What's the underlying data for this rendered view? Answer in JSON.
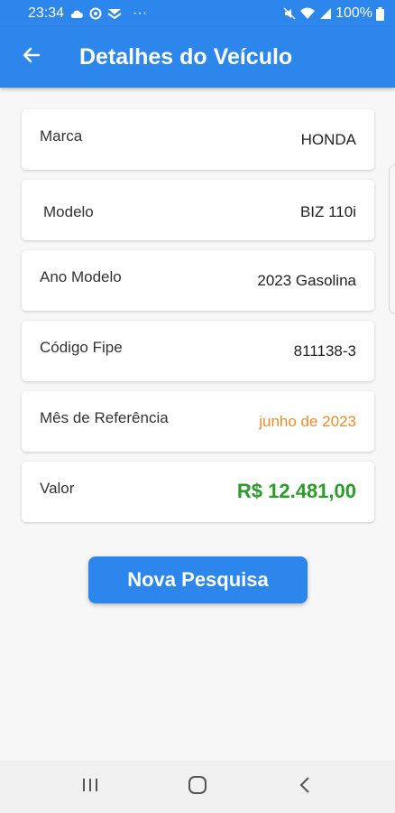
{
  "status_bar": {
    "time": "23:34",
    "more": "···",
    "battery": "100%",
    "icons": [
      "cloud-icon",
      "sync-icon",
      "message-icon",
      "mute-icon",
      "wifi-icon",
      "signal-icon",
      "battery-icon"
    ]
  },
  "app_bar": {
    "title": "Detalhes do Veículo",
    "back_icon": "arrow-left-icon"
  },
  "details": [
    {
      "label": "Marca",
      "value": "HONDA"
    },
    {
      "label": "Modelo",
      "value": "BIZ 110i"
    },
    {
      "label": "Ano Modelo",
      "value": "2023 Gasolina"
    },
    {
      "label": "Código Fipe",
      "value": "811138-3"
    },
    {
      "label": "Mês de Referência",
      "value": "junho de 2023"
    },
    {
      "label": "Valor",
      "value": "R$ 12.481,00"
    }
  ],
  "actions": {
    "new_search": "Nova Pesquisa"
  },
  "nav_bar": {
    "icons": [
      "recent-apps-icon",
      "home-icon",
      "back-icon"
    ]
  },
  "colors": {
    "primary": "#2d86ec",
    "month": "#ef8a2c",
    "price": "#2b9b2a",
    "background": "#f7f7f7"
  }
}
